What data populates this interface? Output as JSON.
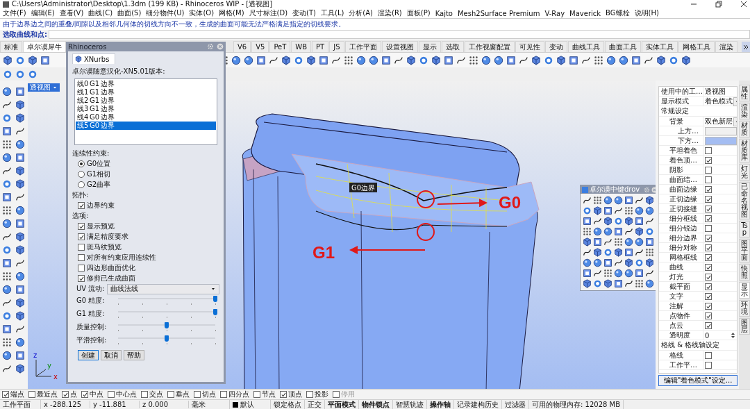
{
  "window": {
    "title": "C:\\Users\\Administrator\\Desktop\\1.3dm (199 KB) - Rhinoceros WIP - [透视图]"
  },
  "menu": [
    "文件(F)",
    "编辑(E)",
    "查看(V)",
    "曲线(C)",
    "曲面(S)",
    "细分物件(U)",
    "实体(O)",
    "网格(M)",
    "尺寸标注(D)",
    "变动(T)",
    "工具(L)",
    "分析(A)",
    "渲染(R)",
    "面板(P)",
    "Kajto",
    "Mesh2Surface Premium",
    "V-Ray",
    "Maverick",
    "BG螺栓",
    "说明(H)"
  ],
  "command": {
    "message": "由于边界边之间的重叠/间隙以及相邻几何体的切线方向不一致，生成的曲面可能无法严格满足指定的切线要求。",
    "prompt": "选取曲线和点:"
  },
  "tabs_left": [
    {
      "label": "标准",
      "selected": false
    },
    {
      "label": "卓尔谟犀牛",
      "selected": true
    }
  ],
  "tabs_right": [
    {
      "label": "V6",
      "selected": false
    },
    {
      "label": "V5",
      "selected": false
    },
    {
      "label": "PeT",
      "selected": false
    },
    {
      "label": "WB",
      "selected": false
    },
    {
      "label": "PT",
      "selected": false
    },
    {
      "label": "JS",
      "selected": false
    },
    {
      "label": "工作平面",
      "selected": false
    },
    {
      "label": "设置视图",
      "selected": false
    },
    {
      "label": "显示",
      "selected": false
    },
    {
      "label": "选取",
      "selected": false
    },
    {
      "label": "工作视窗配置",
      "selected": false
    },
    {
      "label": "可见性",
      "selected": false
    },
    {
      "label": "变动",
      "selected": false
    },
    {
      "label": "曲线工具",
      "selected": false
    },
    {
      "label": "曲面工具",
      "selected": false
    },
    {
      "label": "实体工具",
      "selected": false
    },
    {
      "label": "网格工具",
      "selected": false
    },
    {
      "label": "渲染",
      "selected": false
    }
  ],
  "viewport": {
    "label": "透视图",
    "tag": "G0边界",
    "callouts": [
      "G0",
      "G1"
    ],
    "axis_labels": [
      "x",
      "y",
      "z"
    ]
  },
  "float_toolbar": {
    "title": "卓尔谟中键drov"
  },
  "dialog": {
    "title": "Rhinoceros",
    "tab": "XNurbs",
    "group": "卓尔谟随意汉化-XN5.01版本:",
    "edges": [
      {
        "cells": [
          "线0",
          "G1",
          "边界"
        ],
        "selected": false
      },
      {
        "cells": [
          "线1",
          "G1",
          "边界"
        ],
        "selected": false
      },
      {
        "cells": [
          "线2",
          "G1",
          "边界"
        ],
        "selected": false
      },
      {
        "cells": [
          "线3",
          "G1",
          "边界"
        ],
        "selected": false
      },
      {
        "cells": [
          "线4",
          "G0",
          "边界"
        ],
        "selected": false
      },
      {
        "cells": [
          "线5",
          "G0",
          "边界"
        ],
        "selected": true
      }
    ],
    "continuity_label": "连续性约束:",
    "continuity": [
      {
        "label": "G0位置",
        "selected": true
      },
      {
        "label": "G1相切",
        "selected": false
      },
      {
        "label": "G2曲率",
        "selected": false
      }
    ],
    "topology_label": "拓扑:",
    "topology": [
      {
        "label": "边界约束",
        "checked": true
      }
    ],
    "options_label": "选项:",
    "options": [
      {
        "label": "显示预览",
        "checked": true
      },
      {
        "label": "满足精度要求",
        "checked": true
      },
      {
        "label": "斑马纹预览",
        "checked": false
      },
      {
        "label": "对所有约束应用连续性",
        "checked": false
      },
      {
        "label": "四边形曲面优化",
        "checked": false
      },
      {
        "label": "修剪已生成曲面",
        "checked": true
      }
    ],
    "uv_label": "UV 流动:",
    "uv_value": "曲线法线",
    "sliders": [
      {
        "label": "G0 精度:",
        "level": 1
      },
      {
        "label": "G1 精度:",
        "level": 1
      },
      {
        "label": "质量控制:",
        "level": 0.5
      },
      {
        "label": "平滑控制:",
        "level": 0.5
      }
    ],
    "buttons": [
      {
        "label": "创建",
        "default": true
      },
      {
        "label": "取消",
        "default": false
      },
      {
        "label": "帮助",
        "default": false
      }
    ]
  },
  "properties": {
    "rows": [
      {
        "kind": "text",
        "label": "使用中的工…",
        "value": "透视图"
      },
      {
        "kind": "dropdown",
        "label": "显示模式",
        "value": "着色模式"
      },
      {
        "kind": "section",
        "label": "常规设定",
        "children": [
          {
            "kind": "dropdown",
            "label": "背景",
            "value": "双色新层",
            "children": [
              {
                "kind": "color",
                "label": "上方…",
                "color": "#f0f0f0"
              },
              {
                "kind": "color",
                "label": "下方…",
                "color": "#a4bdf2"
              }
            ]
          },
          {
            "kind": "checkbox",
            "label": "平坦着色",
            "checked": false
          },
          {
            "kind": "checkbox",
            "label": "着色顶…",
            "checked": true
          },
          {
            "kind": "checkbox",
            "label": "阴影",
            "checked": false
          },
          {
            "kind": "checkbox",
            "label": "曲面结…",
            "checked": false
          },
          {
            "kind": "checkbox",
            "label": "曲面边缘",
            "checked": true
          },
          {
            "kind": "checkbox",
            "label": "正切边缘",
            "checked": true
          },
          {
            "kind": "checkbox",
            "label": "正切接缝",
            "checked": true
          },
          {
            "kind": "checkbox",
            "label": "细分框线",
            "checked": true
          },
          {
            "kind": "checkbox",
            "label": "细分锐边",
            "checked": false
          },
          {
            "kind": "checkbox",
            "label": "细分边界",
            "checked": true
          },
          {
            "kind": "checkbox",
            "label": "细分对称",
            "checked": true
          },
          {
            "kind": "checkbox",
            "label": "网格框线",
            "checked": true
          },
          {
            "kind": "checkbox",
            "label": "曲线",
            "checked": true
          },
          {
            "kind": "checkbox",
            "label": "灯光",
            "checked": true
          },
          {
            "kind": "checkbox",
            "label": "截平面",
            "checked": true
          },
          {
            "kind": "checkbox",
            "label": "文字",
            "checked": true
          },
          {
            "kind": "checkbox",
            "label": "注解",
            "checked": true
          },
          {
            "kind": "checkbox",
            "label": "点物件",
            "checked": true
          },
          {
            "kind": "checkbox",
            "label": "点云",
            "checked": true
          },
          {
            "kind": "spin",
            "label": "透明度",
            "value": "0"
          }
        ]
      },
      {
        "kind": "section",
        "label": "格线 & 格线轴设定",
        "children": [
          {
            "kind": "checkbox",
            "label": "格线",
            "checked": false
          },
          {
            "kind": "checkbox",
            "label": "工作平…",
            "checked": false
          }
        ]
      }
    ],
    "button": "编辑\"着色模式\"设定..."
  },
  "side_tabs": [
    {
      "label": "属性",
      "selected": false
    },
    {
      "label": "渲染",
      "selected": false
    },
    {
      "label": "材质",
      "selected": false
    },
    {
      "label": "材质库",
      "selected": false
    },
    {
      "label": "灯光",
      "selected": false
    },
    {
      "label": "已命名视图",
      "selected": false
    },
    {
      "label": "Tsp",
      "selected": false
    },
    {
      "label": "图平面",
      "selected": false
    },
    {
      "label": "快照",
      "selected": false
    },
    {
      "label": "显示",
      "selected": true
    },
    {
      "label": "环境",
      "selected": false
    },
    {
      "label": "图层",
      "selected": false
    }
  ],
  "osnaps": [
    {
      "label": "端点",
      "checked": true,
      "disabled": false
    },
    {
      "label": "最近点",
      "checked": false,
      "disabled": false
    },
    {
      "label": "点",
      "checked": true,
      "disabled": false
    },
    {
      "label": "中点",
      "checked": true,
      "disabled": false
    },
    {
      "label": "中心点",
      "checked": false,
      "disabled": false
    },
    {
      "label": "交点",
      "checked": false,
      "disabled": false
    },
    {
      "label": "垂点",
      "checked": false,
      "disabled": false
    },
    {
      "label": "切点",
      "checked": false,
      "disabled": false
    },
    {
      "label": "四分点",
      "checked": false,
      "disabled": false
    },
    {
      "label": "节点",
      "checked": false,
      "disabled": false
    },
    {
      "label": "顶点",
      "checked": true,
      "disabled": false
    },
    {
      "label": "投影",
      "checked": false,
      "disabled": false
    },
    {
      "label": "停用",
      "checked": false,
      "disabled": true
    }
  ],
  "status": {
    "cplane": "工作平面",
    "coords": [
      "x -288.125",
      "y -11.881",
      "z 0.000"
    ],
    "units": "毫米",
    "layer": "默认",
    "toggles": [
      {
        "label": "锁定格点",
        "on": false
      },
      {
        "label": "正交",
        "on": false
      },
      {
        "label": "平面模式",
        "on": true
      },
      {
        "label": "物件锁点",
        "on": true
      },
      {
        "label": "智慧轨迹",
        "on": false
      },
      {
        "label": "操作轴",
        "on": true
      },
      {
        "label": "记录建构历史",
        "on": false
      },
      {
        "label": "过滤器",
        "on": false
      }
    ],
    "memory": "可用的物理内存: 12028 MB"
  }
}
